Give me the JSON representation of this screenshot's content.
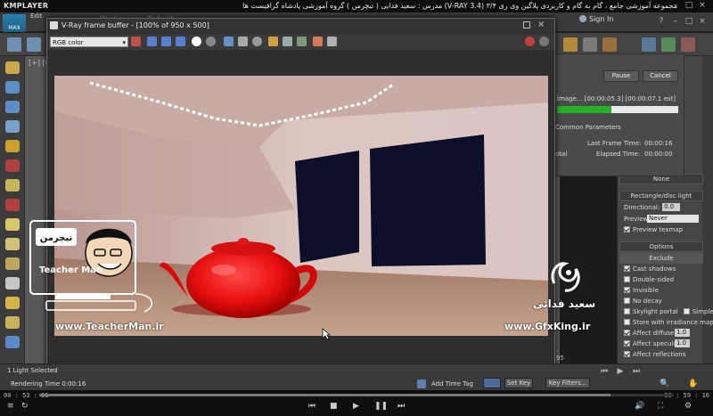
{
  "player": {
    "logo": "KMPLAYER",
    "title": "مجموعه آموزشی جامع ، گام به گام و کاربردی پلاگین وی ری ۳/۴  (V-RAY 3.4)  مدرس : سعید فدایی ( تیچرمن ) گروه آموزشی پادشاه گرافیست ها",
    "time_current": "00 : 53 : 31",
    "time_total": "00 : 59 : 16",
    "seek_fraction": 0.9
  },
  "max": {
    "logo_label": "MAX",
    "edit_menu": "Edit",
    "workspace": "Workspaces: Default",
    "sign_in": "Sign In",
    "viewport_label": "[+] [C",
    "light_selected": "1 Light Selected",
    "rendering_time_label": "Rendering Time  0:00:16",
    "add_time_tag": "Add Time Tag",
    "set_key": "Set Key",
    "key_filters": "Key Filters...",
    "timeline_num": "95"
  },
  "progress_dialog": {
    "pause": "Pause",
    "cancel": "Cancel",
    "image_line": "image... [00:00:05.3] [00:00:07.1 est]",
    "progress_fraction": 0.45,
    "section": "Common Parameters",
    "last_frame_label": "Last Frame Time:",
    "last_frame_value": "00:00:16",
    "elapsed_label": "Elapsed Time:",
    "elapsed_value": "00:00:00",
    "total_label": "otal"
  },
  "vfb": {
    "title": "V-Ray frame buffer - [100% of 950 x 500]",
    "channel": "RGB color"
  },
  "right_panel": {
    "none_label": "None",
    "rect_header": "Rectangle/disc light",
    "directional_label": "Directional:",
    "directional_value": "0.0",
    "preview_label": "Preview:",
    "preview_value": "Never",
    "preview_texmap": "Preview texmap",
    "options_header": "Options",
    "exclude": "Exclude",
    "options": [
      {
        "label": "Cast shadows",
        "checked": true
      },
      {
        "label": "Double-sided",
        "checked": false
      },
      {
        "label": "Invisible",
        "checked": true
      },
      {
        "label": "No decay",
        "checked": false
      },
      {
        "label": "Skylight portal",
        "checked": false,
        "extra": "Simple"
      },
      {
        "label": "Store with irradiance map",
        "checked": false
      },
      {
        "label": "Affect diffuse",
        "checked": true,
        "value": "1.0"
      },
      {
        "label": "Affect specular",
        "checked": true,
        "value": "1.0"
      },
      {
        "label": "Affect reflections",
        "checked": true
      }
    ]
  },
  "watermarks": {
    "teacher_brand": "تیچرمن",
    "teacher_name": "Teacher Man",
    "teacher_site": "www.TeacherMan.ir",
    "gfx_name": "سعید فدائی",
    "gfx_site": "www.GfxKing.ir"
  }
}
